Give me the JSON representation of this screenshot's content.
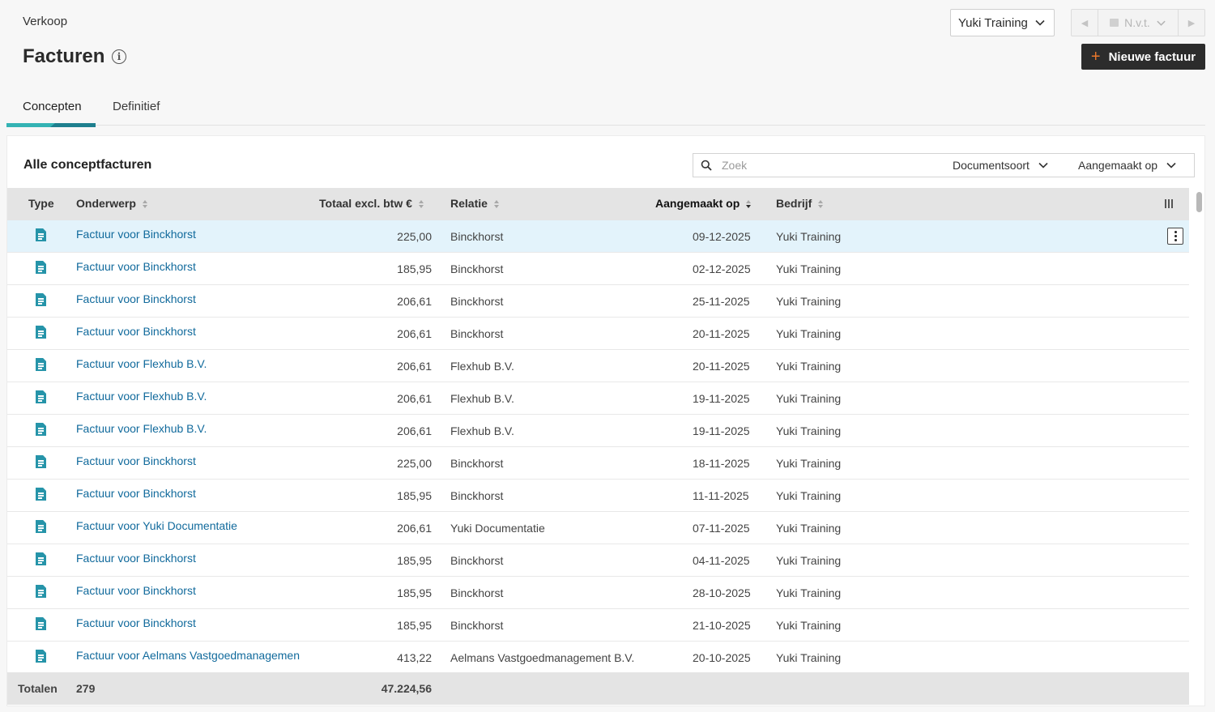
{
  "breadcrumb": "Verkoop",
  "page_title": "Facturen",
  "company_select": "Yuki Training",
  "period": "N.v.t.",
  "new_button": "Nieuwe factuur",
  "tabs": [
    {
      "label": "Concepten",
      "active": true
    },
    {
      "label": "Definitief",
      "active": false
    }
  ],
  "card_title": "Alle conceptfacturen",
  "search": {
    "placeholder": "Zoek",
    "value": ""
  },
  "filters": {
    "document_type": "Documentsoort",
    "created_on": "Aangemaakt op"
  },
  "columns": {
    "type": "Type",
    "subject": "Onderwerp",
    "total": "Totaal excl. btw €",
    "relation": "Relatie",
    "created": "Aangemaakt op",
    "company": "Bedrijf"
  },
  "rows": [
    {
      "subject": "Factuur voor Binckhorst",
      "total": "225,00",
      "relation": "Binckhorst",
      "created": "09-12-2025",
      "company": "Yuki Training"
    },
    {
      "subject": "Factuur voor Binckhorst",
      "total": "185,95",
      "relation": "Binckhorst",
      "created": "02-12-2025",
      "company": "Yuki Training"
    },
    {
      "subject": "Factuur voor Binckhorst",
      "total": "206,61",
      "relation": "Binckhorst",
      "created": "25-11-2025",
      "company": "Yuki Training"
    },
    {
      "subject": "Factuur voor Binckhorst",
      "total": "206,61",
      "relation": "Binckhorst",
      "created": "20-11-2025",
      "company": "Yuki Training"
    },
    {
      "subject": "Factuur voor Flexhub B.V.",
      "total": "206,61",
      "relation": "Flexhub B.V.",
      "created": "20-11-2025",
      "company": "Yuki Training"
    },
    {
      "subject": "Factuur voor Flexhub B.V.",
      "total": "206,61",
      "relation": "Flexhub B.V.",
      "created": "19-11-2025",
      "company": "Yuki Training"
    },
    {
      "subject": "Factuur voor Flexhub B.V.",
      "total": "206,61",
      "relation": "Flexhub B.V.",
      "created": "19-11-2025",
      "company": "Yuki Training"
    },
    {
      "subject": "Factuur voor Binckhorst",
      "total": "225,00",
      "relation": "Binckhorst",
      "created": "18-11-2025",
      "company": "Yuki Training"
    },
    {
      "subject": "Factuur voor Binckhorst",
      "total": "185,95",
      "relation": "Binckhorst",
      "created": "11-11-2025",
      "company": "Yuki Training"
    },
    {
      "subject": "Factuur voor Yuki Documentatie",
      "total": "206,61",
      "relation": "Yuki Documentatie",
      "created": "07-11-2025",
      "company": "Yuki Training"
    },
    {
      "subject": "Factuur voor Binckhorst",
      "total": "185,95",
      "relation": "Binckhorst",
      "created": "04-11-2025",
      "company": "Yuki Training"
    },
    {
      "subject": "Factuur voor Binckhorst",
      "total": "185,95",
      "relation": "Binckhorst",
      "created": "28-10-2025",
      "company": "Yuki Training"
    },
    {
      "subject": "Factuur voor Binckhorst",
      "total": "185,95",
      "relation": "Binckhorst",
      "created": "21-10-2025",
      "company": "Yuki Training"
    },
    {
      "subject": "Factuur voor Aelmans Vastgoedmanagement B.V.",
      "total": "413,22",
      "relation": "Aelmans Vastgoedmanagement B.V.",
      "created": "20-10-2025",
      "company": "Yuki Training"
    }
  ],
  "totals": {
    "label": "Totalen",
    "count": "279",
    "sum": "47.224,56"
  },
  "colors": {
    "accent": "#1e7f8e",
    "link": "#116a9c",
    "selected_row": "#e3f3fb",
    "button": "#2c2c2c",
    "button_plus": "#e9772c"
  },
  "icons": {
    "info": "info-icon",
    "search": "search-icon",
    "doc": "document-icon",
    "columns": "columns-icon",
    "more": "more-vertical-icon"
  }
}
